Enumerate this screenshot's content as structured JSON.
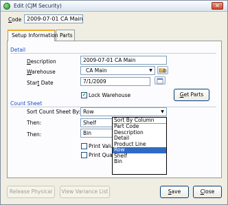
{
  "window": {
    "title": "Edit (CJM Security)",
    "close_glyph": "✕"
  },
  "code": {
    "label_underlined": "C",
    "label_rest": "ode",
    "value": "2009-07-01 CA Main"
  },
  "tabs": [
    {
      "label": "Setup Information",
      "active": true
    },
    {
      "label": "Parts",
      "active": false
    }
  ],
  "detail": {
    "section_label": "Detail",
    "description_label_u": "D",
    "description_label_rest": "escription",
    "description_value": "2009-07-01 CA Main",
    "warehouse_label_u": "W",
    "warehouse_label_rest": "arehouse",
    "warehouse_value": "CA Main",
    "start_date_label_pre": "Star",
    "start_date_label_u": "t",
    "start_date_label_post": " Date",
    "start_date_value": "7/1/2009",
    "lock_warehouse_label": "Lock Warehouse",
    "lock_warehouse_checked": true,
    "get_parts_label_u": "G",
    "get_parts_label_rest": "et Parts"
  },
  "count_sheet": {
    "section_label": "Count Sheet",
    "sort_label": "Sort Count Sheet By:",
    "sort_value": "Row",
    "then1_label": "Then:",
    "then1_value": "Shelf",
    "then2_label": "Then:",
    "then2_value": "Bin",
    "print_values_label": "Print Value",
    "print_quantity_label": "Print Quan"
  },
  "dropdown": {
    "header": "Sort By Column",
    "options": [
      "Part Code",
      "Description",
      "Detail",
      "Product Line",
      "Row",
      "Shelf",
      "Bin"
    ],
    "selected": "Row"
  },
  "footer": {
    "release_physical": "Release Physical",
    "view_variance_list": "View Variance List",
    "save_u": "S",
    "save_rest": "ave",
    "close_u": "C",
    "close_rest": "lose"
  },
  "colors": {
    "accent": "#1c4fc9",
    "selection": "#316ac5",
    "tab_highlight": "#f5a623"
  },
  "icons": {
    "warehouse_lookup": "warehouse-lookup-icon",
    "calendar": "calendar-icon",
    "app": "app-icon"
  }
}
